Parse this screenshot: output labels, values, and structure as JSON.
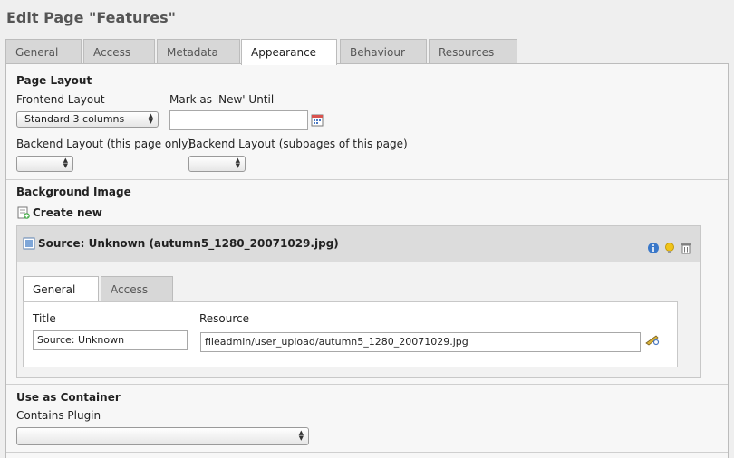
{
  "page_title": "Edit Page \"Features\"",
  "tabs": [
    {
      "label": "General"
    },
    {
      "label": "Access"
    },
    {
      "label": "Metadata"
    },
    {
      "label": "Appearance"
    },
    {
      "label": "Behaviour"
    },
    {
      "label": "Resources"
    }
  ],
  "active_tab": "Appearance",
  "page_layout": {
    "heading": "Page Layout",
    "frontend_layout_label": "Frontend Layout",
    "frontend_layout_value": "Standard 3 columns",
    "mark_new_label": "Mark as 'New' Until",
    "mark_new_value": "",
    "backend_layout_label": "Backend Layout (this page only)",
    "backend_layout_sub_label": "Backend Layout (subpages of this page)"
  },
  "background_image": {
    "heading": "Background Image",
    "create_new_label": "Create new",
    "record_title": "Source: Unknown (autumn5_1280_20071029.jpg)",
    "subtabs": [
      {
        "label": "General"
      },
      {
        "label": "Access"
      }
    ],
    "title_label": "Title",
    "title_value": "Source: Unknown",
    "resource_label": "Resource",
    "resource_value": "fileadmin/user_upload/autumn5_1280_20071029.jpg"
  },
  "container": {
    "heading": "Use as Container",
    "contains_plugin_label": "Contains Plugin",
    "contains_plugin_value": ""
  },
  "colors": {
    "accent_info": "#3a78c9",
    "accent_bulb": "#f0c419"
  }
}
